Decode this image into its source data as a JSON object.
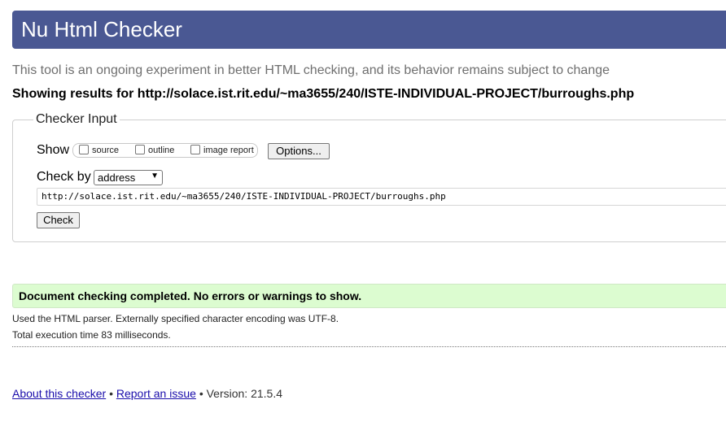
{
  "header": {
    "title": "Nu Html Checker",
    "subtitle": "This tool is an ongoing experiment in better HTML checking, and its behavior remains subject to change",
    "results_for": "Showing results for http://solace.ist.rit.edu/~ma3655/240/ISTE-INDIVIDUAL-PROJECT/burroughs.php",
    "banner_color": "#4a5893"
  },
  "checker_input": {
    "legend": "Checker Input",
    "show_label": "Show",
    "options": [
      {
        "label": "source",
        "checked": false
      },
      {
        "label": "outline",
        "checked": false
      },
      {
        "label": "image report",
        "checked": false
      }
    ],
    "options_button": "Options...",
    "check_by_label": "Check by",
    "check_by_value": "address",
    "url_value": "http://solace.ist.rit.edu/~ma3655/240/ISTE-INDIVIDUAL-PROJECT/burroughs.php",
    "check_button": "Check"
  },
  "result": {
    "message": "Document checking completed. No errors or warnings to show.",
    "success_color": "#dcfcd0",
    "parser_info": "Used the HTML parser. Externally specified character encoding was UTF-8.",
    "execution_time": "Total execution time 83 milliseconds."
  },
  "footer": {
    "about_link": "About this checker",
    "separator": "•",
    "report_link": "Report an issue",
    "version": "Version: 21.5.4"
  }
}
